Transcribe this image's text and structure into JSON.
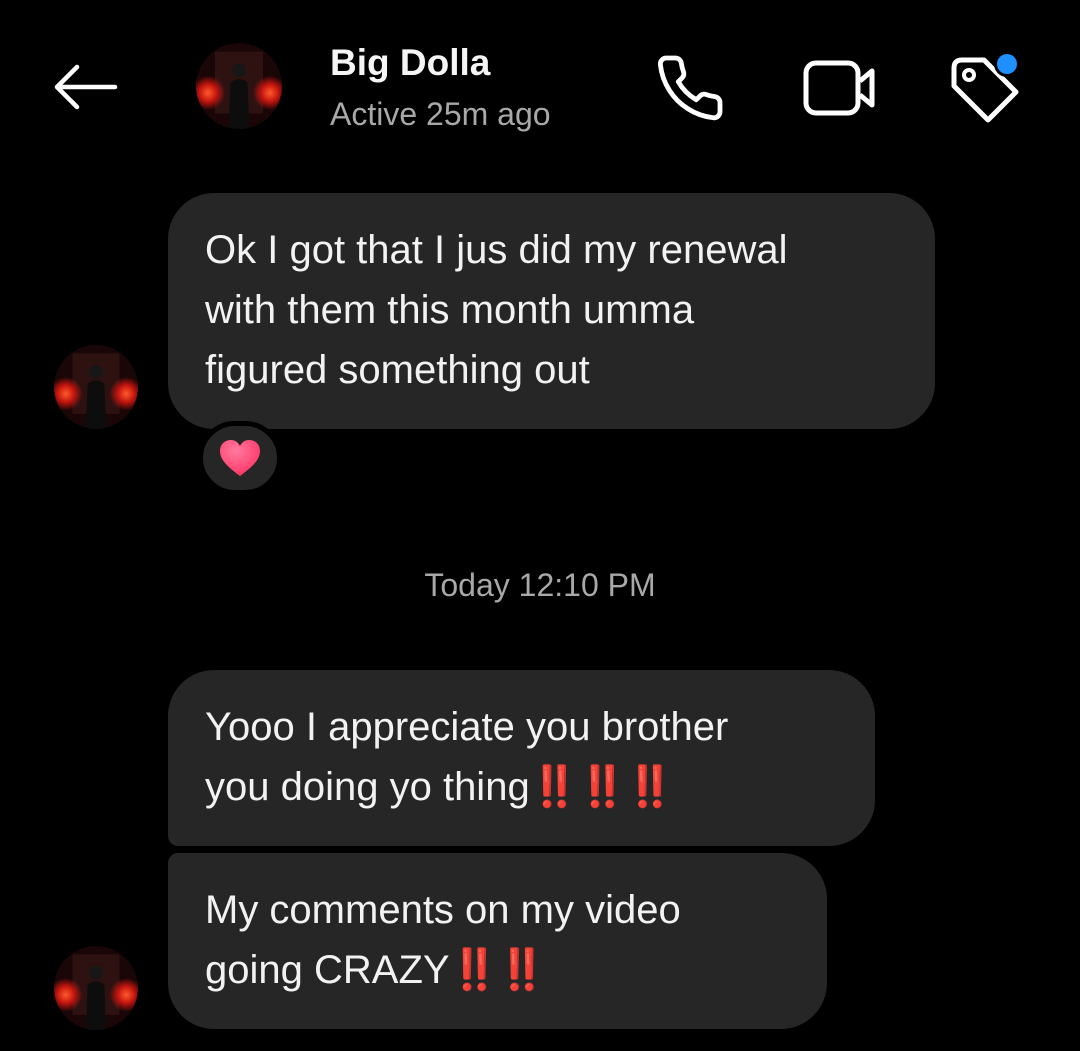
{
  "header": {
    "name": "Big Dolla",
    "status": "Active 25m ago",
    "back_icon": "arrow-left-icon",
    "call_icon": "phone-icon",
    "video_icon": "video-camera-icon",
    "tag_icon": "tag-icon",
    "tag_badge_color": "#1e90ff"
  },
  "messages": [
    {
      "lines": [
        "Ok I got that I jus did my renewal",
        "with them this month umma",
        "figured something out"
      ],
      "reaction": "❤️"
    },
    {
      "lines": [
        "Yooo I appreciate you brother",
        "you doing yo thing"
      ],
      "emphasis": "‼️‼️‼️"
    },
    {
      "lines": [
        "My comments on my video",
        "going CRAZY"
      ],
      "emphasis": "‼️‼️"
    }
  ],
  "timestamp": "Today 12:10 PM",
  "colors": {
    "background": "#000000",
    "bubble": "#262626",
    "text": "#f2f2f2",
    "muted": "#a8a8a8",
    "exclamation": "#e0141b",
    "heart": "#ff3a6e"
  }
}
